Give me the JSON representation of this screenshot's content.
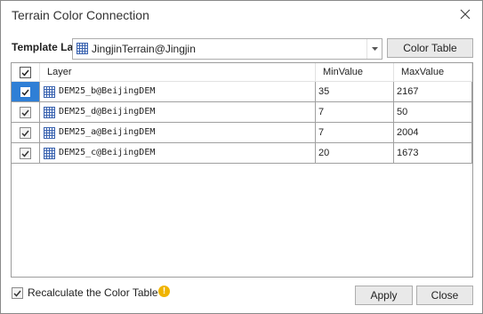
{
  "window": {
    "title": "Terrain Color Connection"
  },
  "template": {
    "label": "Template Layer",
    "value": "JingjinTerrain@Jingjin"
  },
  "buttons": {
    "color_table": "Color Table",
    "apply": "Apply",
    "close": "Close"
  },
  "table": {
    "headers": {
      "layer": "Layer",
      "min": "MinValue",
      "max": "MaxValue"
    },
    "rows": [
      {
        "layer": "DEM25_b@BeijingDEM",
        "min": "35",
        "max": "2167",
        "checked": true,
        "selected": true
      },
      {
        "layer": "DEM25_d@BeijingDEM",
        "min": "7",
        "max": "50",
        "checked": true,
        "selected": false
      },
      {
        "layer": "DEM25_a@BeijingDEM",
        "min": "7",
        "max": "2004",
        "checked": true,
        "selected": false
      },
      {
        "layer": "DEM25_c@BeijingDEM",
        "min": "20",
        "max": "1673",
        "checked": true,
        "selected": false
      }
    ]
  },
  "footer": {
    "recalc_label": "Recalculate the Color Table",
    "recalc_checked": true
  },
  "icons": {
    "layer": "grid-layer-icon",
    "warning": "warning-icon",
    "close": "close-icon"
  },
  "colors": {
    "selection": "#2f7fd6",
    "warning": "#f0b400"
  }
}
